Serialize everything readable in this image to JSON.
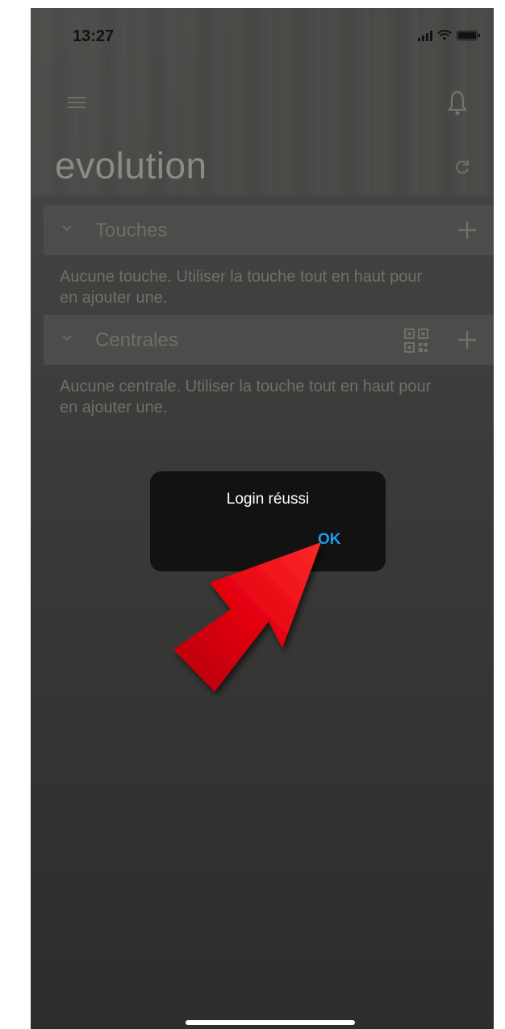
{
  "status_bar": {
    "time": "13:27"
  },
  "header": {
    "title": "evolution",
    "icons": [
      "menu-icon",
      "bell-icon",
      "refresh-icon"
    ]
  },
  "sections": [
    {
      "label": "Touches",
      "empty_message": "Aucune touche. Utiliser la touche tout en haut pour en ajouter une.",
      "actions": [
        "plus-icon"
      ]
    },
    {
      "label": "Centrales",
      "empty_message": "Aucune centrale. Utiliser la touche tout en haut pour en ajouter une.",
      "actions": [
        "qr-code-icon",
        "plus-icon"
      ]
    }
  ],
  "dialog": {
    "message": "Login réussi",
    "ok_label": "OK"
  },
  "colors": {
    "ok_accent": "#1e9bf0",
    "annotation_arrow": "#e3000f",
    "dialog_bg": "#121212"
  }
}
